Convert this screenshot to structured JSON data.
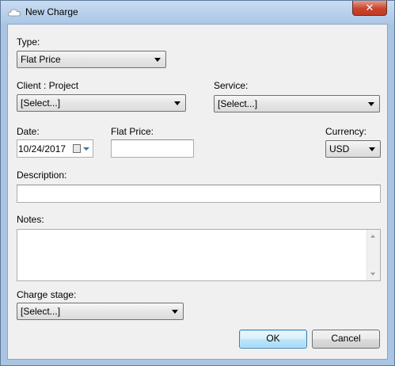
{
  "window": {
    "title": "New Charge",
    "close_label": "✕"
  },
  "form": {
    "type": {
      "label": "Type:",
      "value": "Flat Price"
    },
    "client_project": {
      "label": "Client : Project",
      "value": "[Select...]"
    },
    "service": {
      "label": "Service:",
      "value": "[Select...]"
    },
    "date": {
      "label": "Date:",
      "value": "10/24/2017"
    },
    "flat_price": {
      "label": "Flat Price:",
      "value": ""
    },
    "currency": {
      "label": "Currency:",
      "value": "USD"
    },
    "description": {
      "label": "Description:",
      "value": ""
    },
    "notes": {
      "label": "Notes:",
      "value": ""
    },
    "charge_stage": {
      "label": "Charge stage:",
      "value": "[Select...]"
    }
  },
  "buttons": {
    "ok": "OK",
    "cancel": "Cancel"
  },
  "icons": {
    "app": "cloud-icon",
    "date_picker": "calendar-icon",
    "dropdown": "chevron-down-icon"
  }
}
